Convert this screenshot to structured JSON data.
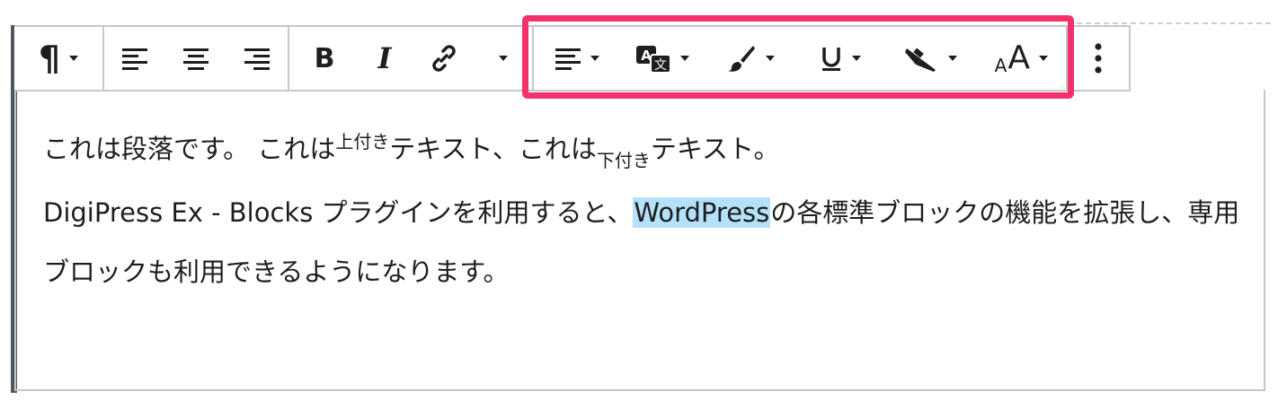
{
  "toolbar": {
    "paragraph_icon": "¶",
    "bold_label": "B",
    "italic_label": "I",
    "font_size_small": "A",
    "font_size_large": "A"
  },
  "highlight_color": "#f2336b",
  "selection_color": "#b5e1fb",
  "content": {
    "p1_part1": "これは段落です。 これは",
    "p1_sup": "上付き",
    "p1_part2": "テキスト、これは",
    "p1_sub": "下付き",
    "p1_part3": "テキスト。",
    "p2_part1": "DigiPress Ex - Blocks プラグインを利用すると、",
    "p2_selected": "WordPress",
    "p2_part2": "の各標準ブロックの機能を拡張し、専用ブロックも利用できるようになります。"
  }
}
